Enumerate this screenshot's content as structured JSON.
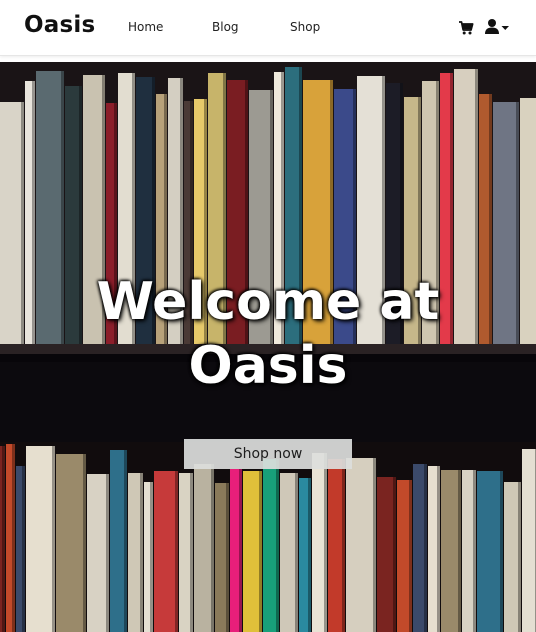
{
  "navbar": {
    "brand": "Oasis",
    "links": [
      "Home",
      "Blog",
      "Shop"
    ],
    "icons": [
      "cart-icon",
      "user-icon",
      "caret-down-icon"
    ]
  },
  "hero": {
    "title_line1": "Welcome at",
    "title_line2": "Oasis",
    "button_label": "Shop now"
  }
}
